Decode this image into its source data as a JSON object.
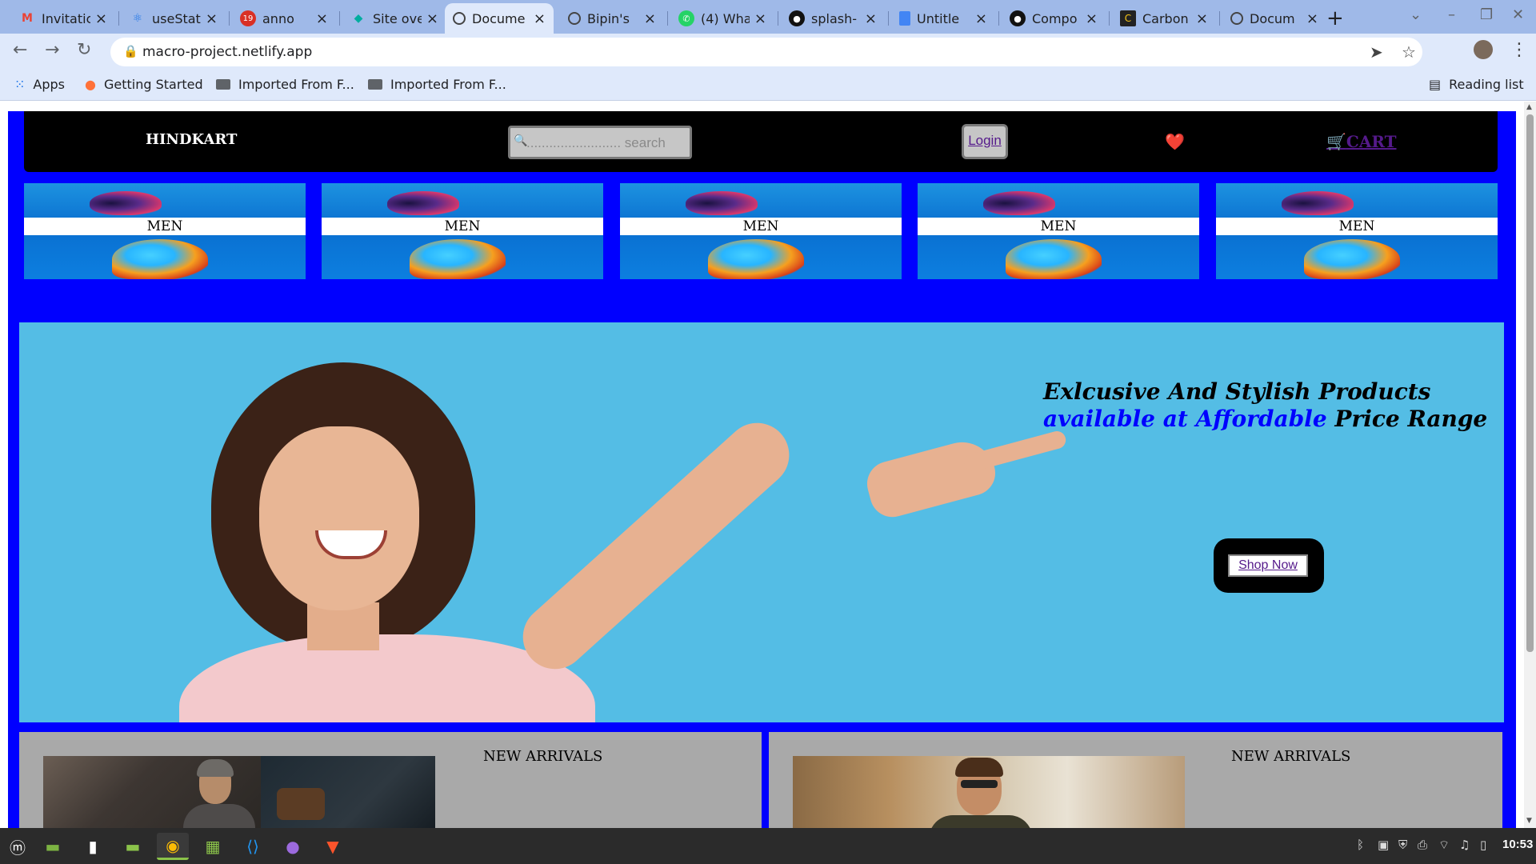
{
  "browser": {
    "tabs": [
      {
        "title": "Invitatic",
        "icon": "gmail-icon",
        "color": "#ea4335"
      },
      {
        "title": "useStat",
        "icon": "react-icon",
        "color": "#61dafb"
      },
      {
        "title": "anno",
        "icon": "calendar-badge-icon",
        "badge": "19",
        "color": "#d93025"
      },
      {
        "title": "Site ove",
        "icon": "netlify-icon",
        "color": "#00ad9f"
      },
      {
        "title": "Docume",
        "icon": "globe-icon",
        "color": "#444"
      },
      {
        "title": "Bipin's",
        "icon": "globe-icon",
        "color": "#444"
      },
      {
        "title": "(4) Wha",
        "icon": "whatsapp-icon",
        "color": "#25d366"
      },
      {
        "title": "splash-",
        "icon": "github-icon",
        "color": "#111"
      },
      {
        "title": "Untitle",
        "icon": "docs-icon",
        "color": "#4285f4"
      },
      {
        "title": "Compo",
        "icon": "github-icon",
        "color": "#111"
      },
      {
        "title": "Carbon",
        "icon": "carbon-icon",
        "color": "#222"
      },
      {
        "title": "Docum",
        "icon": "globe-icon",
        "color": "#444"
      }
    ],
    "active_tab_index": 4,
    "url": "macro-project.netlify.app",
    "bookmarks": {
      "apps": "Apps",
      "getting_started": "Getting Started",
      "imported_1": "Imported From F...",
      "imported_2": "Imported From F...",
      "reading_list": "Reading list"
    }
  },
  "site": {
    "brand": "HINDKART",
    "search_placeholder": "......................... search",
    "login": "Login",
    "heart": "❤️",
    "cart_icon": "🛒",
    "cart": "CART",
    "categories": [
      "MEN",
      "MEN",
      "MEN",
      "MEN",
      "MEN"
    ],
    "hero": {
      "line_black_1": "Exlcusive And Stylish Products ",
      "line_blue": "available at Affordable",
      "line_black_2": " Price Range",
      "shop_button": "Shop Now"
    },
    "arrivals": [
      "NEW ARRIVALS",
      "NEW ARRIVALS"
    ]
  },
  "taskbar": {
    "clock": "10:53"
  },
  "colors": {
    "site_bg": "#0000ff",
    "nav_bg": "#000000",
    "hero_bg": "#54bde5",
    "arrivals_bg": "#a9a9a9",
    "link": "#551a8b"
  }
}
